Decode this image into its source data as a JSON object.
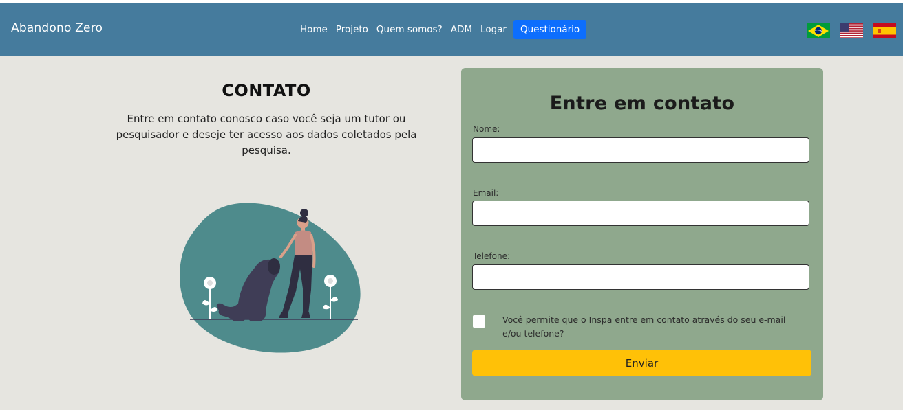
{
  "navbar": {
    "brand": "Abandono Zero",
    "links": [
      "Home",
      "Projeto",
      "Quem somos?",
      "ADM",
      "Logar",
      "Questionário"
    ],
    "flags": [
      "brazil-flag",
      "usa-flag",
      "spain-flag"
    ],
    "bg_color": "#457b9d",
    "active_color": "#0d6efd"
  },
  "left": {
    "title": "CONTATO",
    "text": "Entre em contato conosco caso você seja um tutor ou pesquisador e deseje ter acesso aos dados coletados pela pesquisa."
  },
  "form": {
    "title": "Entre em contato",
    "name_label": "Nome:",
    "email_label": "Email:",
    "phone_label": "Telefone:",
    "name_value": "",
    "email_value": "",
    "phone_value": "",
    "consent_text": "Você permite que o Inspa entre em contato através do seu e-mail e/ou telefone?",
    "submit_label": "Enviar",
    "card_color": "#8fa88d",
    "button_color": "#ffc107"
  }
}
